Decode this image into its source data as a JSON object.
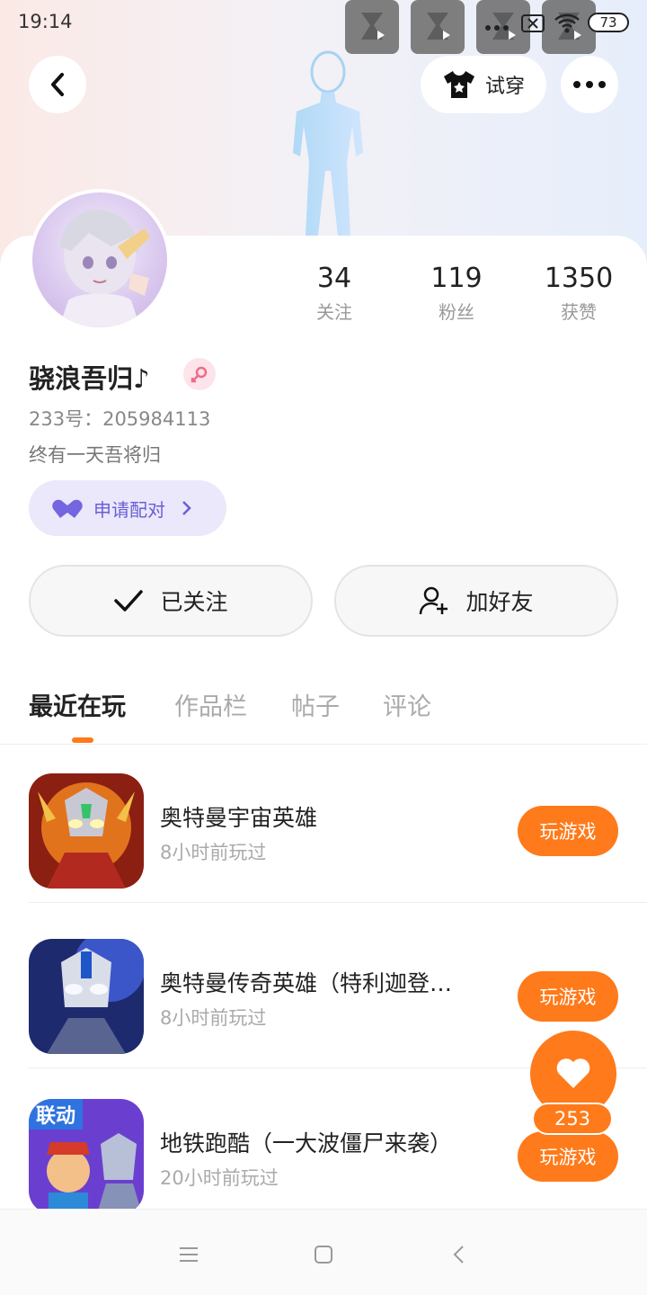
{
  "status_bar": {
    "time": "19:14",
    "battery": "73"
  },
  "header": {
    "tryon_label": "试穿"
  },
  "profile": {
    "nickname": "骁浪吾归♪",
    "uid": "233号：205984113",
    "bio": "终有一天吾将归",
    "match_label": "申请配对",
    "stats": [
      {
        "value": "34",
        "label": "关注"
      },
      {
        "value": "119",
        "label": "粉丝"
      },
      {
        "value": "1350",
        "label": "获赞"
      }
    ],
    "followed_label": "已关注",
    "add_friend_label": "加好友"
  },
  "tabs": [
    {
      "label": "最近在玩",
      "active": true
    },
    {
      "label": "作品栏",
      "active": false
    },
    {
      "label": "帖子",
      "active": false
    },
    {
      "label": "评论",
      "active": false
    }
  ],
  "games": [
    {
      "name": "奥特曼宇宙英雄",
      "time": "8小时前玩过",
      "button": "玩游戏"
    },
    {
      "name": "奥特曼传奇英雄（特利迦登…",
      "time": "8小时前玩过",
      "button": "玩游戏"
    },
    {
      "name": "地铁跑酷（一大波僵尸来袭）",
      "time": "20小时前玩过",
      "button": "玩游戏"
    }
  ],
  "fab": {
    "count": "253"
  },
  "game_icon_text": {
    "game3_badge": "联动"
  },
  "colors": {
    "accent": "#ff7a1a",
    "match": "#6a5fd6"
  }
}
